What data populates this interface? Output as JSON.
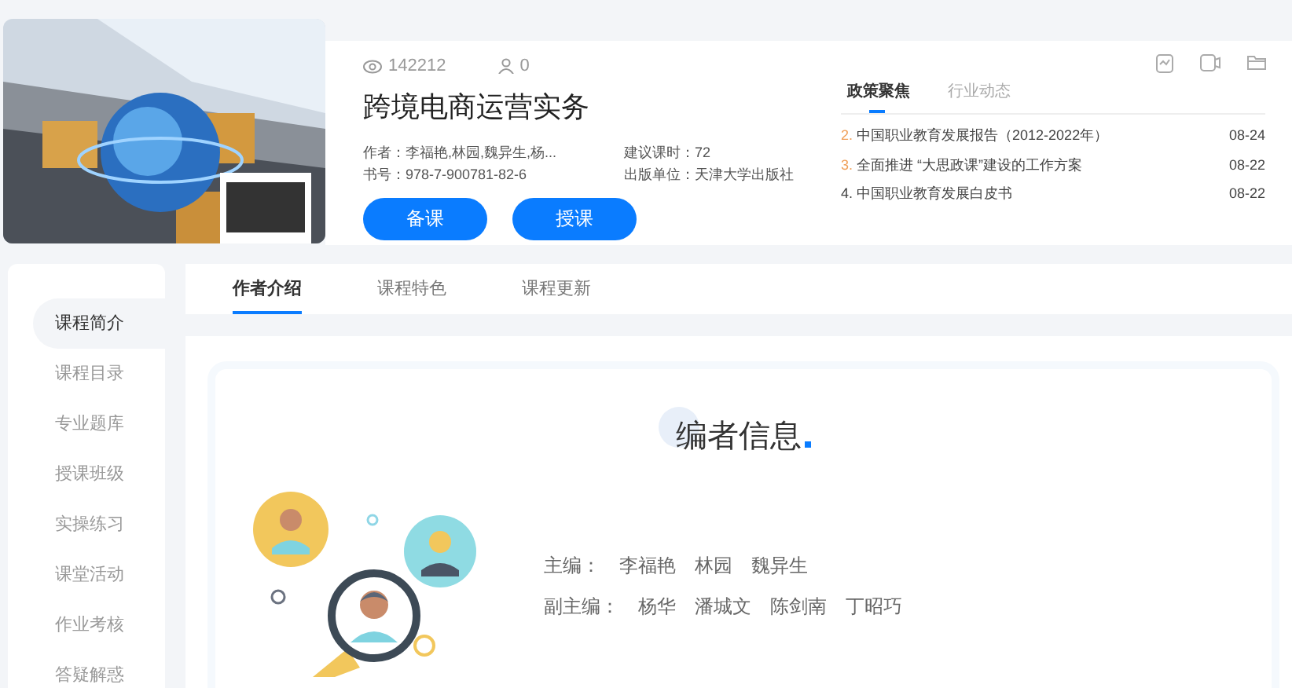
{
  "course": {
    "views": "142212",
    "likes": "0",
    "title": "跨境电商运营实务",
    "meta": [
      {
        "label": "作者：",
        "value": "李福艳,林园,魏异生,杨..."
      },
      {
        "label": "建议课时：",
        "value": "72"
      },
      {
        "label": "书号：",
        "value": "978-7-900781-82-6"
      },
      {
        "label": "出版单位：",
        "value": "天津大学出版社"
      }
    ],
    "buttons": [
      "备课",
      "授课"
    ]
  },
  "news": {
    "tabs": [
      {
        "label": "政策聚焦",
        "selected": true
      },
      {
        "label": "行业动态",
        "selected": false
      }
    ],
    "items": [
      {
        "rank": "2.",
        "title": "中国职业教育发展报告（2012-2022年）",
        "date": "08-24",
        "highlighted": true
      },
      {
        "rank": "3.",
        "title": "全面推进 “大思政课”建设的工作方案",
        "date": "08-22",
        "highlighted": true
      },
      {
        "rank": "4.",
        "title": "中国职业教育发展白皮书",
        "date": "08-22",
        "highlighted": false
      }
    ]
  },
  "sidebar": {
    "items": [
      {
        "label": "课程简介",
        "selected": true
      },
      {
        "label": "课程目录",
        "selected": false
      },
      {
        "label": "专业题库",
        "selected": false
      },
      {
        "label": "授课班级",
        "selected": false
      },
      {
        "label": "实操练习",
        "selected": false
      },
      {
        "label": "课堂活动",
        "selected": false
      },
      {
        "label": "作业考核",
        "selected": false
      },
      {
        "label": "答疑解惑",
        "selected": false
      }
    ]
  },
  "tabs": [
    {
      "label": "作者介绍",
      "selected": true
    },
    {
      "label": "课程特色",
      "selected": false
    },
    {
      "label": "课程更新",
      "selected": false
    }
  ],
  "editors": {
    "title": "编者信息",
    "rows": [
      {
        "label": "主编：",
        "names": [
          "李福艳",
          "林园",
          "魏异生"
        ]
      },
      {
        "label": "副主编：",
        "names": [
          "杨华",
          "潘城文",
          "陈剑南",
          "丁昭巧"
        ]
      }
    ]
  }
}
